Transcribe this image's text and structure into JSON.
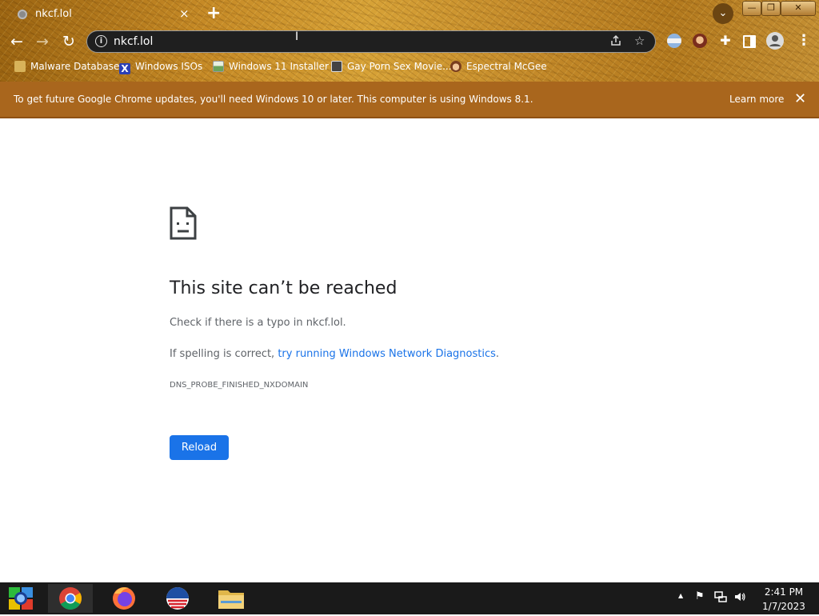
{
  "browser": {
    "tab": {
      "title": "nkcf.lol",
      "close_icon": "×"
    },
    "new_tab_icon": "+",
    "window_controls": {
      "minimize": "—",
      "maximize": "❐",
      "close": "✕"
    },
    "nav": {
      "back_icon": "←",
      "forward_icon": "→",
      "reload_icon": "↻"
    },
    "omnibox": {
      "url": "nkcf.lol",
      "info_icon": "i"
    },
    "bookmarks": [
      {
        "label": "Malware Database",
        "icon": "folder-icon",
        "color": "#d8b35a"
      },
      {
        "label": "Windows ISOs",
        "icon": "x-icon",
        "color": "#2b3fb5"
      },
      {
        "label": "Windows 11 Installer",
        "icon": "image-icon",
        "color": "#6aa35a"
      },
      {
        "label": "Gay Porn Sex Movie...",
        "icon": "thumbnail-icon",
        "color": "#444444"
      },
      {
        "label": "Espectral McGee",
        "icon": "avatar-icon",
        "color": "#7a3f1f"
      }
    ]
  },
  "infobar": {
    "message": "To get future Google Chrome updates, you'll need Windows 10 or later. This computer is using Windows 8.1.",
    "learn_more": "Learn more",
    "close_icon": "✕"
  },
  "error_page": {
    "title": "This site can’t be reached",
    "typo_hint": "Check if there is a typo in nkcf.lol.",
    "spelling_prefix": "If spelling is correct, ",
    "diagnostics_link": "try running Windows Network Diagnostics",
    "spelling_suffix": ".",
    "error_code": "DNS_PROBE_FINISHED_NXDOMAIN",
    "reload_button": "Reload"
  },
  "taskbar": {
    "apps": [
      "start-button",
      "chrome",
      "firefox",
      "obama-campaign",
      "file-explorer"
    ],
    "tray": {
      "show_hidden_icon": "▲",
      "flag_icon": "⚑",
      "network_icon": "🖧",
      "volume_icon": "🔊"
    },
    "clock": {
      "time": "2:41 PM",
      "date": "1/7/2023"
    }
  },
  "colors": {
    "infobar": "#a9661d",
    "link": "#1a73e8",
    "reload_button": "#1a73e8",
    "title_text": "#202124",
    "body_text": "#5f6368"
  }
}
